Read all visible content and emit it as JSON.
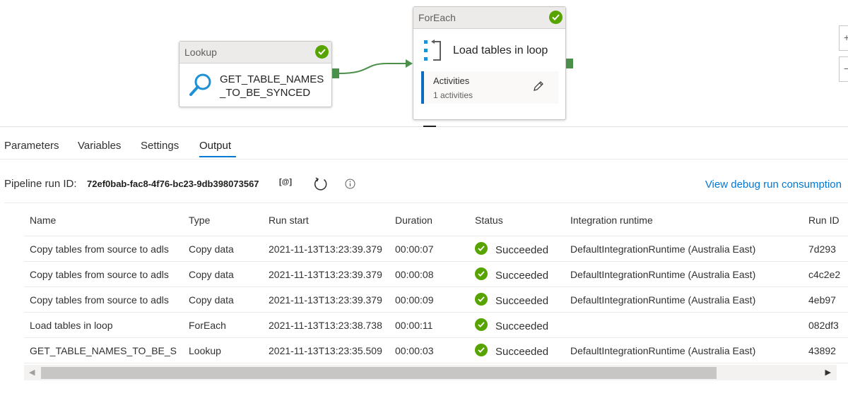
{
  "canvas": {
    "lookup": {
      "header": "Lookup",
      "title": "GET_TABLE_NAMES_TO_BE_SYNCED"
    },
    "foreach": {
      "header": "ForEach",
      "title": "Load tables in loop",
      "activities_label": "Activities",
      "activities_count": "1 activities"
    },
    "status_color": "#57a300",
    "side_buttons": [
      "+",
      "−"
    ]
  },
  "tabs": [
    "Parameters",
    "Variables",
    "Settings",
    "Output"
  ],
  "active_tab": "Output",
  "run": {
    "label": "Pipeline run ID:",
    "id": "72ef0bab-fac8-4f76-bc23-9db398073567",
    "copy_icon": "[@]",
    "debug_link": "View debug run consumption"
  },
  "table": {
    "columns": [
      "Name",
      "Type",
      "Run start",
      "Duration",
      "Status",
      "Integration runtime",
      "Run ID"
    ],
    "rows": [
      {
        "name": "Copy tables from source to adls",
        "type": "Copy data",
        "run_start": "2021-11-13T13:23:39.379",
        "duration": "00:00:07",
        "status": "Succeeded",
        "ir": "DefaultIntegrationRuntime (Australia East)",
        "run_id": "7d293"
      },
      {
        "name": "Copy tables from source to adls",
        "type": "Copy data",
        "run_start": "2021-11-13T13:23:39.379",
        "duration": "00:00:08",
        "status": "Succeeded",
        "ir": "DefaultIntegrationRuntime (Australia East)",
        "run_id": "c4c2e2"
      },
      {
        "name": "Copy tables from source to adls",
        "type": "Copy data",
        "run_start": "2021-11-13T13:23:39.379",
        "duration": "00:00:09",
        "status": "Succeeded",
        "ir": "DefaultIntegrationRuntime (Australia East)",
        "run_id": "4eb97"
      },
      {
        "name": "Load tables in loop",
        "type": "ForEach",
        "run_start": "2021-11-13T13:23:38.738",
        "duration": "00:00:11",
        "status": "Succeeded",
        "ir": "",
        "run_id": "082df3"
      },
      {
        "name": "GET_TABLE_NAMES_TO_BE_SYNC",
        "type": "Lookup",
        "run_start": "2021-11-13T13:23:35.509",
        "duration": "00:00:03",
        "status": "Succeeded",
        "ir": "DefaultIntegrationRuntime (Australia East)",
        "run_id": "43892"
      }
    ]
  },
  "scrollbar": {
    "left_arrow": "◀",
    "right_arrow": "▶"
  }
}
